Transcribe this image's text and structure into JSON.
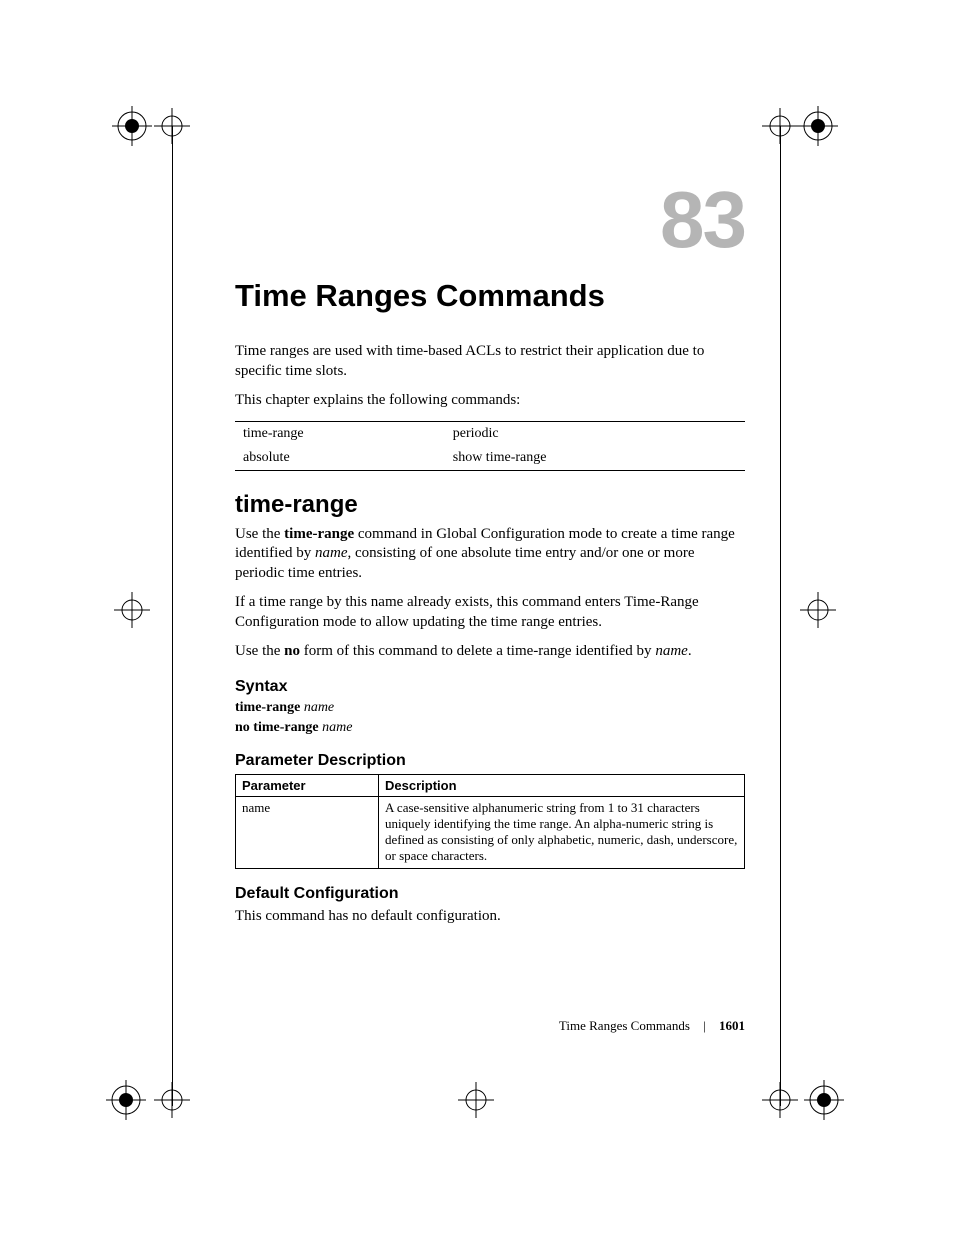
{
  "chapter": {
    "number": "83",
    "title": "Time Ranges Commands"
  },
  "intro": {
    "p1": "Time ranges are used with time-based ACLs to restrict their application due to specific time slots.",
    "p2": "This chapter explains the following commands:"
  },
  "command_list": {
    "r1c1": "time-range",
    "r1c2": "periodic",
    "r2c1": "absolute",
    "r2c2": "show time-range"
  },
  "section": {
    "heading": "time-range",
    "p1_a": "Use the ",
    "p1_b": "time-range",
    "p1_c": " command in Global Configuration mode to create a time range identified by ",
    "p1_d": "name",
    "p1_e": ", consisting of one absolute time entry and/or one or more periodic time entries.",
    "p2": "If a time range by this name already exists, this command enters Time-Range Configuration mode to allow updating the time range entries.",
    "p3_a": "Use the ",
    "p3_b": "no",
    "p3_c": " form of this command to delete a time-range identified by ",
    "p3_d": "name",
    "p3_e": "."
  },
  "syntax": {
    "heading": "Syntax",
    "l1_a": "time-range ",
    "l1_b": "name",
    "l2_a": "no time-range ",
    "l2_b": "name"
  },
  "param": {
    "heading": "Parameter Description",
    "col1": "Parameter",
    "col2": "Description",
    "row1_param": "name",
    "row1_desc": "A case-sensitive alphanumeric string from 1 to 31 characters uniquely identifying the time range. An alpha-numeric string is defined as consisting of only alphabetic, numeric, dash, underscore, or space characters."
  },
  "default_cfg": {
    "heading": "Default Configuration",
    "p": "This command has no default configuration."
  },
  "footer": {
    "section": "Time Ranges Commands",
    "page": "1601"
  }
}
